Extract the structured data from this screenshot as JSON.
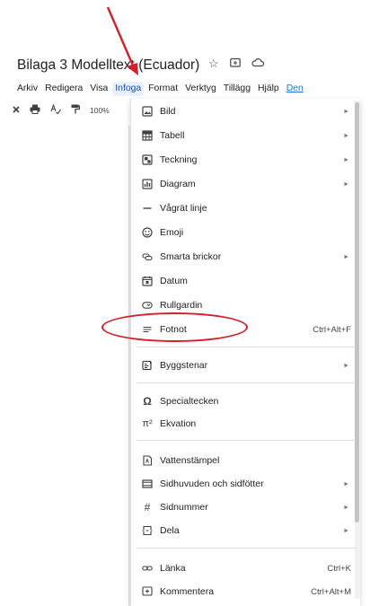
{
  "document": {
    "title": "Bilaga 3 Modelltext (Ecuador)",
    "title_icons": [
      "star-icon",
      "move-to-folder-icon",
      "cloud-status-icon"
    ]
  },
  "menubar": {
    "items": [
      "Arkiv",
      "Redigera",
      "Visa",
      "Infoga",
      "Format",
      "Verktyg",
      "Tillägg",
      "Hjälp",
      "Den"
    ],
    "active": "Infoga"
  },
  "toolbar": {
    "zoom": "100%"
  },
  "insert_menu": {
    "items": [
      {
        "label": "Bild",
        "icon": "image-icon",
        "submenu": true
      },
      {
        "label": "Tabell",
        "icon": "table-icon",
        "submenu": true
      },
      {
        "label": "Teckning",
        "icon": "drawing-icon",
        "submenu": true
      },
      {
        "label": "Diagram",
        "icon": "chart-icon",
        "submenu": true
      },
      {
        "label": "Vågrät linje",
        "icon": "horizontal-line-icon",
        "submenu": false
      },
      {
        "label": "Emoji",
        "icon": "emoji-icon",
        "submenu": false
      },
      {
        "label": "Smarta brickor",
        "icon": "smart-chips-icon",
        "submenu": true
      },
      {
        "label": "Datum",
        "icon": "calendar-icon",
        "submenu": false
      },
      {
        "label": "Rullgardin",
        "icon": "dropdown-icon",
        "submenu": false
      },
      {
        "label": "Fotnot",
        "icon": "footnote-icon",
        "submenu": false,
        "shortcut": "Ctrl+Alt+F"
      },
      {
        "label": "Byggstenar",
        "icon": "building-blocks-icon",
        "submenu": true
      },
      {
        "label": "Specialtecken",
        "icon": "omega-icon",
        "submenu": false
      },
      {
        "label": "Ekvation",
        "icon": "pi-icon",
        "submenu": false
      },
      {
        "label": "Vattenstämpel",
        "icon": "watermark-icon",
        "submenu": false
      },
      {
        "label": "Sidhuvuden och sidfötter",
        "icon": "header-footer-icon",
        "submenu": true
      },
      {
        "label": "Sidnummer",
        "icon": "hash-icon",
        "submenu": true
      },
      {
        "label": "Dela",
        "icon": "break-icon",
        "submenu": true
      },
      {
        "label": "Länka",
        "icon": "link-icon",
        "submenu": false,
        "shortcut": "Ctrl+K"
      },
      {
        "label": "Kommentera",
        "icon": "comment-icon",
        "submenu": false,
        "shortcut": "Ctrl+Alt+M"
      }
    ]
  },
  "annotation": {
    "color": "#d21f2a"
  }
}
